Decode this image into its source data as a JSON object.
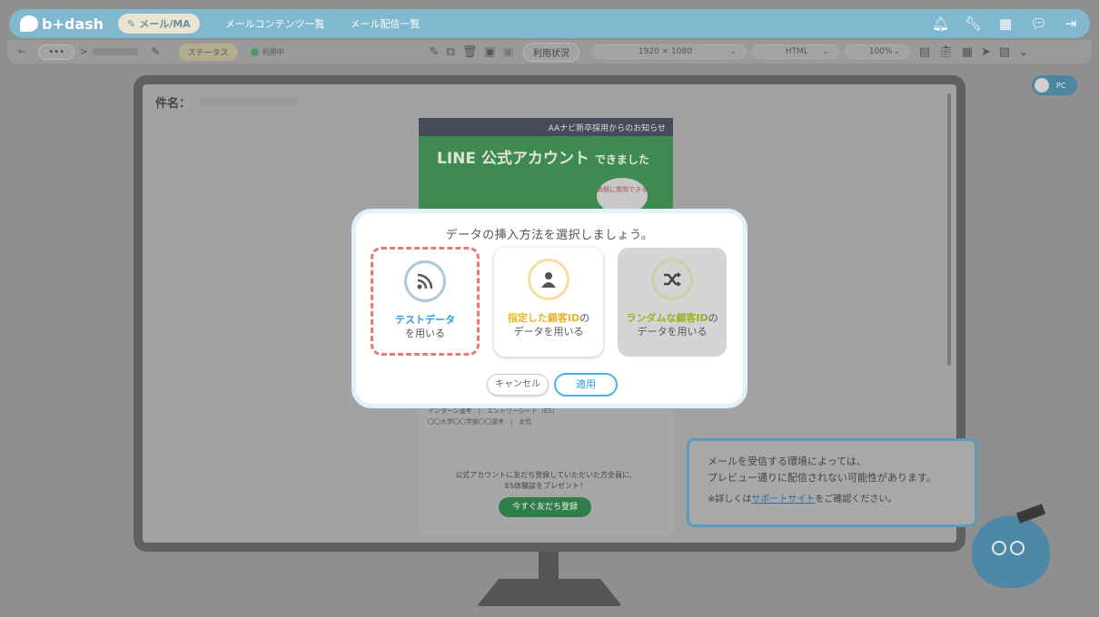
{
  "topbar": {
    "logo": "b+dash",
    "mode_badge": "メール/MA",
    "nav_links": [
      "メールコンテンツ一覧",
      "メール配信一覧"
    ],
    "icons": [
      "bell-icon",
      "wrench-icon",
      "grid-icon",
      "chat-icon",
      "logout-icon"
    ]
  },
  "toolbar": {
    "back": "←",
    "more": "•••",
    "breadcrumb_sep": ">",
    "status_label": "ステータス",
    "status_value": "利用中",
    "usage_button": "利用状況",
    "resolution": "1920 × 1080",
    "format": "HTML",
    "zoom": "100%"
  },
  "pc_toggle": {
    "label": "PC"
  },
  "editor": {
    "subject_label": "件名："
  },
  "email": {
    "header_text": "AAナビ新卒採用からのお知らせ",
    "banner_title": "LINE 公式アカウント",
    "banner_suffix": "できました",
    "banner_bubble": "気軽に質問できる",
    "info_lines": [
      "インターン選考　|　エントリーシート（ES）",
      "〇〇大学〇〇学部〇〇選考　|　女性"
    ],
    "cta_text_1": "公式アカウントに友だち登録していただいた方全員に、",
    "cta_text_2": "ES体験談をプレゼント！",
    "cta_button": "今すぐ友だち登録"
  },
  "dialog": {
    "title": "データの挿入方法を選択しましょう。",
    "options": [
      {
        "accent": "テストデータ",
        "rest": "",
        "line2": "を用いる",
        "icon": "rss-icon"
      },
      {
        "accent": "指定した顧客ID",
        "rest": "の",
        "line2": "データを用いる",
        "icon": "person-icon"
      },
      {
        "accent": "ランダムな顧客ID",
        "rest": "の",
        "line2": "データを用いる",
        "icon": "shuffle-icon"
      }
    ],
    "cancel_label": "キャンセル",
    "apply_label": "適用"
  },
  "notice": {
    "line1": "メールを受信する環境によっては、",
    "line2": "プレビュー通りに配信されない可能性があります。",
    "note_prefix": "※詳しくは",
    "note_link": "サポートサイト",
    "note_suffix": "をご確認ください。"
  },
  "colors": {
    "accent_blue": "#2d9fde",
    "accent_yellow": "#e7b52b",
    "accent_green": "#95b51e",
    "selected_border": "#e9777c"
  }
}
